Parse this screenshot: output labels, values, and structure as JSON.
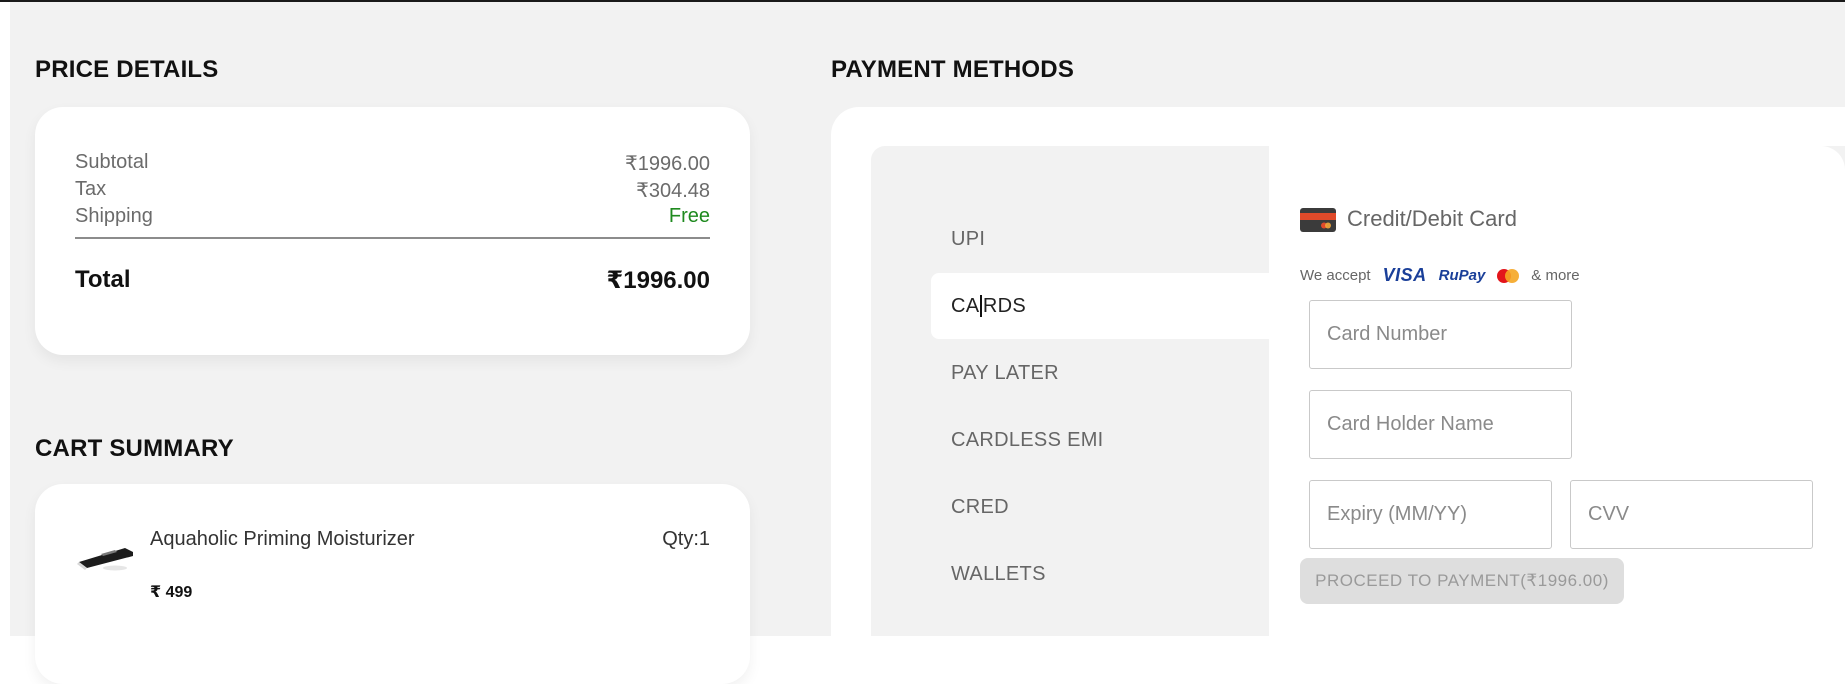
{
  "price_details": {
    "title": "PRICE DETAILS",
    "rows": [
      {
        "label": "Subtotal",
        "value": "₹1996.00"
      },
      {
        "label": "Tax",
        "value": "₹304.48"
      },
      {
        "label": "Shipping",
        "value": "Free"
      }
    ],
    "total_label": "Total",
    "total_value": "₹1996.00",
    "free_color": "#1f8a1f"
  },
  "cart_summary": {
    "title": "CART SUMMARY",
    "item": {
      "name": "Aquaholic Priming Moisturizer",
      "qty": "Qty:1",
      "price": "₹ 499",
      "thumb_icon": "moisturizer-product-image"
    }
  },
  "payment": {
    "title": "PAYMENT METHODS",
    "methods": [
      {
        "label": "UPI"
      },
      {
        "label_before_caret": "CA",
        "label_after_caret": "RDS",
        "label": "CARDS",
        "active": true
      },
      {
        "label": "PAY LATER"
      },
      {
        "label": "CARDLESS EMI"
      },
      {
        "label": "CRED"
      },
      {
        "label": "WALLETS"
      }
    ],
    "form": {
      "icon": "credit-card-icon",
      "title": "Credit/Debit Card",
      "accept_text": "We accept",
      "brands": {
        "visa": "VISA",
        "rupay_ru": "RuPay",
        "mastercard_icon": "mastercard-icon"
      },
      "more_text": "& more",
      "card_number_placeholder": "Card Number",
      "holder_placeholder": "Card Holder Name",
      "expiry_placeholder": "Expiry (MM/YY)",
      "cvv_placeholder": "CVV",
      "proceed_label": "PROCEED TO PAYMENT(₹1996.00)"
    }
  }
}
